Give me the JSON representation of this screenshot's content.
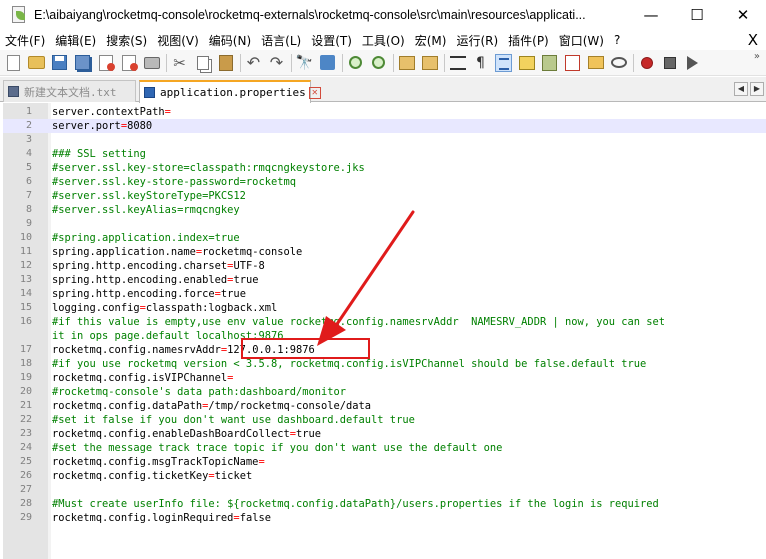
{
  "window": {
    "title": "E:\\aibaiyang\\rocketmq-console\\rocketmq-externals\\rocketmq-console\\src\\main\\resources\\applicati...",
    "minimize_glyph": "—",
    "maximize_glyph": "☐",
    "close_glyph": "✕"
  },
  "menu": {
    "items": [
      {
        "label": "文件(F)"
      },
      {
        "label": "编辑(E)"
      },
      {
        "label": "搜索(S)"
      },
      {
        "label": "视图(V)"
      },
      {
        "label": "编码(N)"
      },
      {
        "label": "语言(L)"
      },
      {
        "label": "设置(T)"
      },
      {
        "label": "工具(O)"
      },
      {
        "label": "宏(M)"
      },
      {
        "label": "运行(R)"
      },
      {
        "label": "插件(P)"
      },
      {
        "label": "窗口(W)"
      },
      {
        "label": "?"
      }
    ],
    "close_doc_glyph": "X"
  },
  "toolbar": {
    "icons": [
      "new-file-icon",
      "open-file-icon",
      "save-icon",
      "save-all-icon",
      "close-file-icon",
      "close-all-icon",
      "print-icon",
      "cut-icon",
      "copy-icon",
      "paste-icon",
      "undo-icon",
      "redo-icon",
      "find-icon",
      "replace-icon",
      "zoom-in-icon",
      "zoom-out-icon",
      "sync-vertical-icon",
      "sync-horizontal-icon",
      "word-wrap-icon",
      "show-all-chars-icon",
      "indent-guide-icon",
      "user-defined-language-icon",
      "document-map-icon",
      "function-list-icon",
      "folder-workspace-icon",
      "monitoring-icon",
      "record-macro-icon",
      "stop-recording-icon",
      "play-macro-icon"
    ],
    "pilcrow_glyph": "¶",
    "overflow_glyph": "»"
  },
  "tabs": [
    {
      "label": "新建文本文档.txt",
      "active": false
    },
    {
      "label": "application.properties",
      "active": true
    }
  ],
  "tab_nav": {
    "prev": "◀",
    "next": "▶"
  },
  "editor": {
    "current_line": 2,
    "lines": [
      {
        "n": "1",
        "kind": "kv",
        "key": "server.contextPath",
        "eq": "=",
        "val": ""
      },
      {
        "n": "2",
        "kind": "kv",
        "key": "server.port",
        "eq": "=",
        "val": "8080"
      },
      {
        "n": "3",
        "kind": "blank"
      },
      {
        "n": "4",
        "kind": "comment",
        "text": "### SSL setting"
      },
      {
        "n": "5",
        "kind": "comment",
        "text": "#server.ssl.key-store=classpath:rmqcngkeystore.jks"
      },
      {
        "n": "6",
        "kind": "comment",
        "text": "#server.ssl.key-store-password=rocketmq"
      },
      {
        "n": "7",
        "kind": "comment",
        "text": "#server.ssl.keyStoreType=PKCS12"
      },
      {
        "n": "8",
        "kind": "comment",
        "text": "#server.ssl.keyAlias=rmqcngkey"
      },
      {
        "n": "9",
        "kind": "blank"
      },
      {
        "n": "10",
        "kind": "comment",
        "text": "#spring.application.index=true"
      },
      {
        "n": "11",
        "kind": "kv",
        "key": "spring.application.name",
        "eq": "=",
        "val": "rocketmq-console"
      },
      {
        "n": "12",
        "kind": "kv",
        "key": "spring.http.encoding.charset",
        "eq": "=",
        "val": "UTF-8"
      },
      {
        "n": "13",
        "kind": "kv",
        "key": "spring.http.encoding.enabled",
        "eq": "=",
        "val": "true"
      },
      {
        "n": "14",
        "kind": "kv",
        "key": "spring.http.encoding.force",
        "eq": "=",
        "val": "true"
      },
      {
        "n": "15",
        "kind": "kv",
        "key": "logging.config",
        "eq": "=",
        "val": "classpath:logback.xml"
      },
      {
        "n": "16",
        "kind": "comment",
        "text": "#if this value is empty,use env value rocketmq.config.namesrvAddr  NAMESRV_ADDR | now, you can set"
      },
      {
        "n": "",
        "kind": "comment",
        "text": "it in ops page.default localhost:9876"
      },
      {
        "n": "17",
        "kind": "kv",
        "key": "rocketmq.config.namesrvAddr",
        "eq": "=",
        "val": "127.0.0.1:9876"
      },
      {
        "n": "18",
        "kind": "comment",
        "text": "#if you use rocketmq version < 3.5.8, rocketmq.config.isVIPChannel should be false.default true"
      },
      {
        "n": "19",
        "kind": "kv",
        "key": "rocketmq.config.isVIPChannel",
        "eq": "=",
        "val": ""
      },
      {
        "n": "20",
        "kind": "comment",
        "text": "#rocketmq-console's data path:dashboard/monitor"
      },
      {
        "n": "21",
        "kind": "kv",
        "key": "rocketmq.config.dataPath",
        "eq": "=",
        "val": "/tmp/rocketmq-console/data"
      },
      {
        "n": "22",
        "kind": "comment",
        "text": "#set it false if you don't want use dashboard.default true"
      },
      {
        "n": "23",
        "kind": "kv",
        "key": "rocketmq.config.enableDashBoardCollect",
        "eq": "=",
        "val": "true"
      },
      {
        "n": "24",
        "kind": "comment",
        "text": "#set the message track trace topic if you don't want use the default one"
      },
      {
        "n": "25",
        "kind": "kv",
        "key": "rocketmq.config.msgTrackTopicName",
        "eq": "=",
        "val": ""
      },
      {
        "n": "26",
        "kind": "kv",
        "key": "rocketmq.config.ticketKey",
        "eq": "=",
        "val": "ticket"
      },
      {
        "n": "27",
        "kind": "blank"
      },
      {
        "n": "28",
        "kind": "comment",
        "text": "#Must create userInfo file: ${rocketmq.config.dataPath}/users.properties if the login is required"
      },
      {
        "n": "29",
        "kind": "kv",
        "key": "rocketmq.config.loginRequired",
        "eq": "=",
        "val": "false"
      }
    ]
  },
  "colors": {
    "comment": "#008000",
    "operator": "#ff0000",
    "current_line": "#e8e8ff",
    "annotation": "#e01b1b",
    "active_tab_accent": "#f5a623"
  }
}
